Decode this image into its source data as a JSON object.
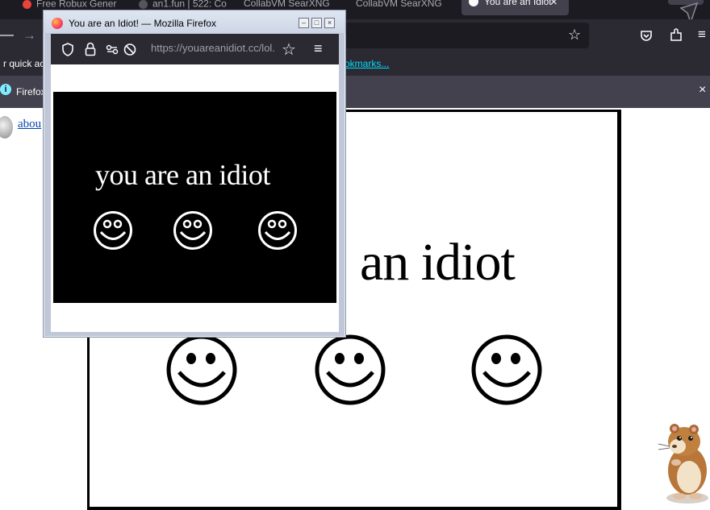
{
  "browser": {
    "tabs": [
      {
        "label": "Free Robux Gener",
        "icon": "robux-tab-icon"
      },
      {
        "label": "an1.fun | 522: Co",
        "icon": "page-icon"
      },
      {
        "label": "CollabVM SearXNG",
        "icon": "none"
      },
      {
        "label": "CollabVM SearXNG",
        "icon": "none"
      }
    ],
    "active_tab": {
      "label": "You are an Idiot",
      "close": "×"
    },
    "bookmarks_text": "r quick acce",
    "bookmarks_link": "okmarks...",
    "info_text": "Firefox",
    "info_close": "×",
    "about_link": "abou"
  },
  "big_page": {
    "title": "an idiot"
  },
  "popup": {
    "title": "You are an Idiot! — Mozilla Firefox",
    "url": "https://youareanidiot.cc/lol.",
    "content_title": "you are an idiot"
  },
  "colors": {
    "tab_bar": "#1c1b22",
    "toolbar": "#2b2a33",
    "info_bar": "#42414d",
    "link": "#00ddff"
  }
}
